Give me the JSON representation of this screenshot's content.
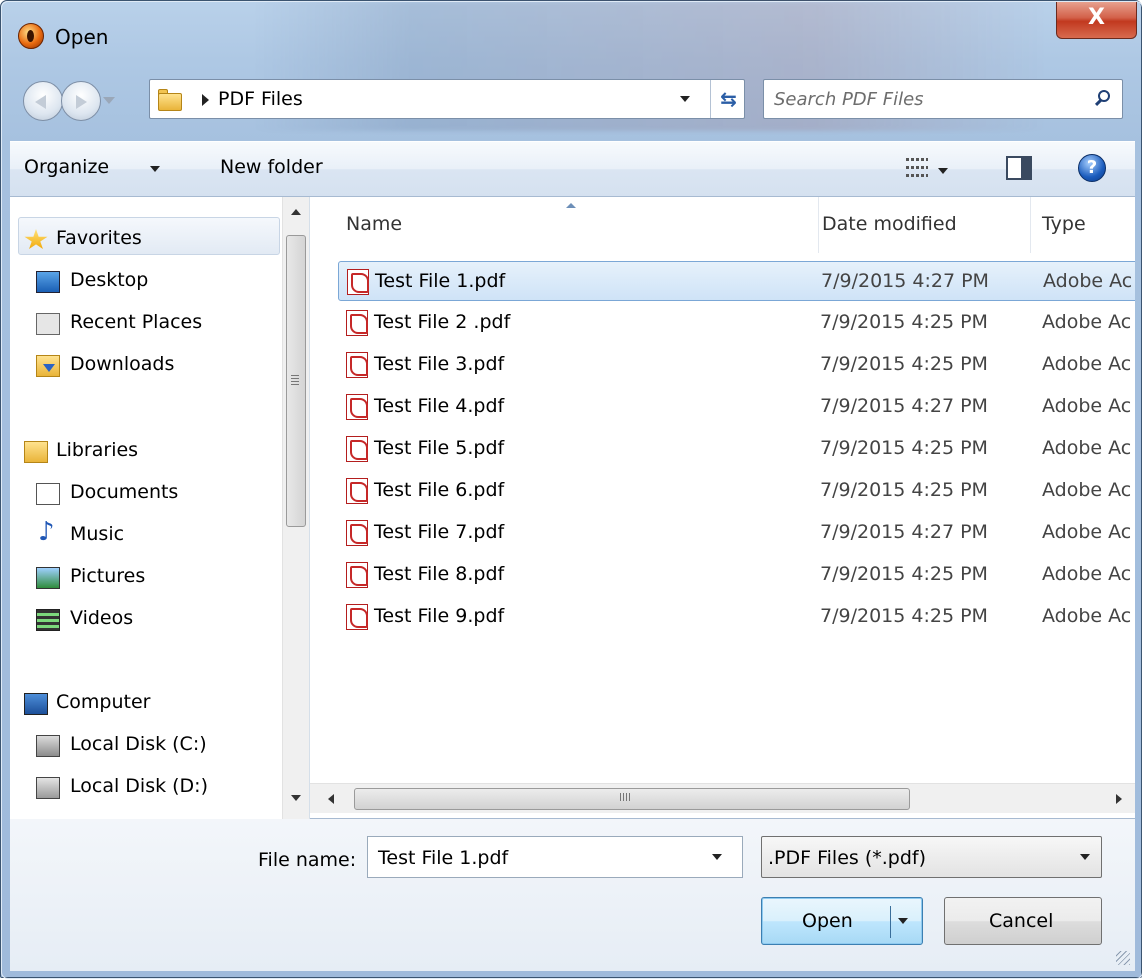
{
  "window": {
    "title": "Open",
    "close_label": "X"
  },
  "nav": {
    "breadcrumb": "PDF Files",
    "refresh_glyph": "⇆",
    "search_placeholder": "Search PDF Files"
  },
  "toolbar": {
    "organize_label": "Organize",
    "new_folder_label": "New folder",
    "help_glyph": "?"
  },
  "sidebar": {
    "items": [
      {
        "label": "Favorites",
        "icon": "star-icon"
      },
      {
        "label": "Desktop",
        "icon": "desktop-icon"
      },
      {
        "label": "Recent Places",
        "icon": "recent-places-icon"
      },
      {
        "label": "Downloads",
        "icon": "downloads-icon"
      },
      {
        "label": "Libraries",
        "icon": "libraries-icon"
      },
      {
        "label": "Documents",
        "icon": "documents-icon"
      },
      {
        "label": "Music",
        "icon": "music-icon"
      },
      {
        "label": "Pictures",
        "icon": "pictures-icon"
      },
      {
        "label": "Videos",
        "icon": "videos-icon"
      },
      {
        "label": "Computer",
        "icon": "computer-icon"
      },
      {
        "label": "Local Disk (C:)",
        "icon": "disk-c-icon"
      },
      {
        "label": "Local Disk (D:)",
        "icon": "disk-d-icon"
      }
    ]
  },
  "files": {
    "columns": [
      "Name",
      "Date modified",
      "Type"
    ],
    "rows": [
      {
        "name": "Test File 1.pdf",
        "date": "7/9/2015 4:27 PM",
        "type": "Adobe Ac"
      },
      {
        "name": "Test File 2 .pdf",
        "date": "7/9/2015 4:25 PM",
        "type": "Adobe Ac"
      },
      {
        "name": "Test File 3.pdf",
        "date": "7/9/2015 4:25 PM",
        "type": "Adobe Ac"
      },
      {
        "name": "Test File 4.pdf",
        "date": "7/9/2015 4:27 PM",
        "type": "Adobe Ac"
      },
      {
        "name": "Test File 5.pdf",
        "date": "7/9/2015 4:25 PM",
        "type": "Adobe Ac"
      },
      {
        "name": "Test File 6.pdf",
        "date": "7/9/2015 4:25 PM",
        "type": "Adobe Ac"
      },
      {
        "name": "Test File 7.pdf",
        "date": "7/9/2015 4:27 PM",
        "type": "Adobe Ac"
      },
      {
        "name": "Test File 8.pdf",
        "date": "7/9/2015 4:25 PM",
        "type": "Adobe Ac"
      },
      {
        "name": "Test File 9.pdf",
        "date": "7/9/2015 4:25 PM",
        "type": "Adobe Ac"
      }
    ]
  },
  "bottom": {
    "file_name_label": "File name:",
    "file_name_value": "Test File 1.pdf",
    "filter_value": ".PDF Files (*.pdf)",
    "open_label": "Open",
    "cancel_label": "Cancel"
  },
  "colors": {
    "selection": "#cfe3f7",
    "accent": "#3c7fb1",
    "close_button": "#c1391f"
  }
}
